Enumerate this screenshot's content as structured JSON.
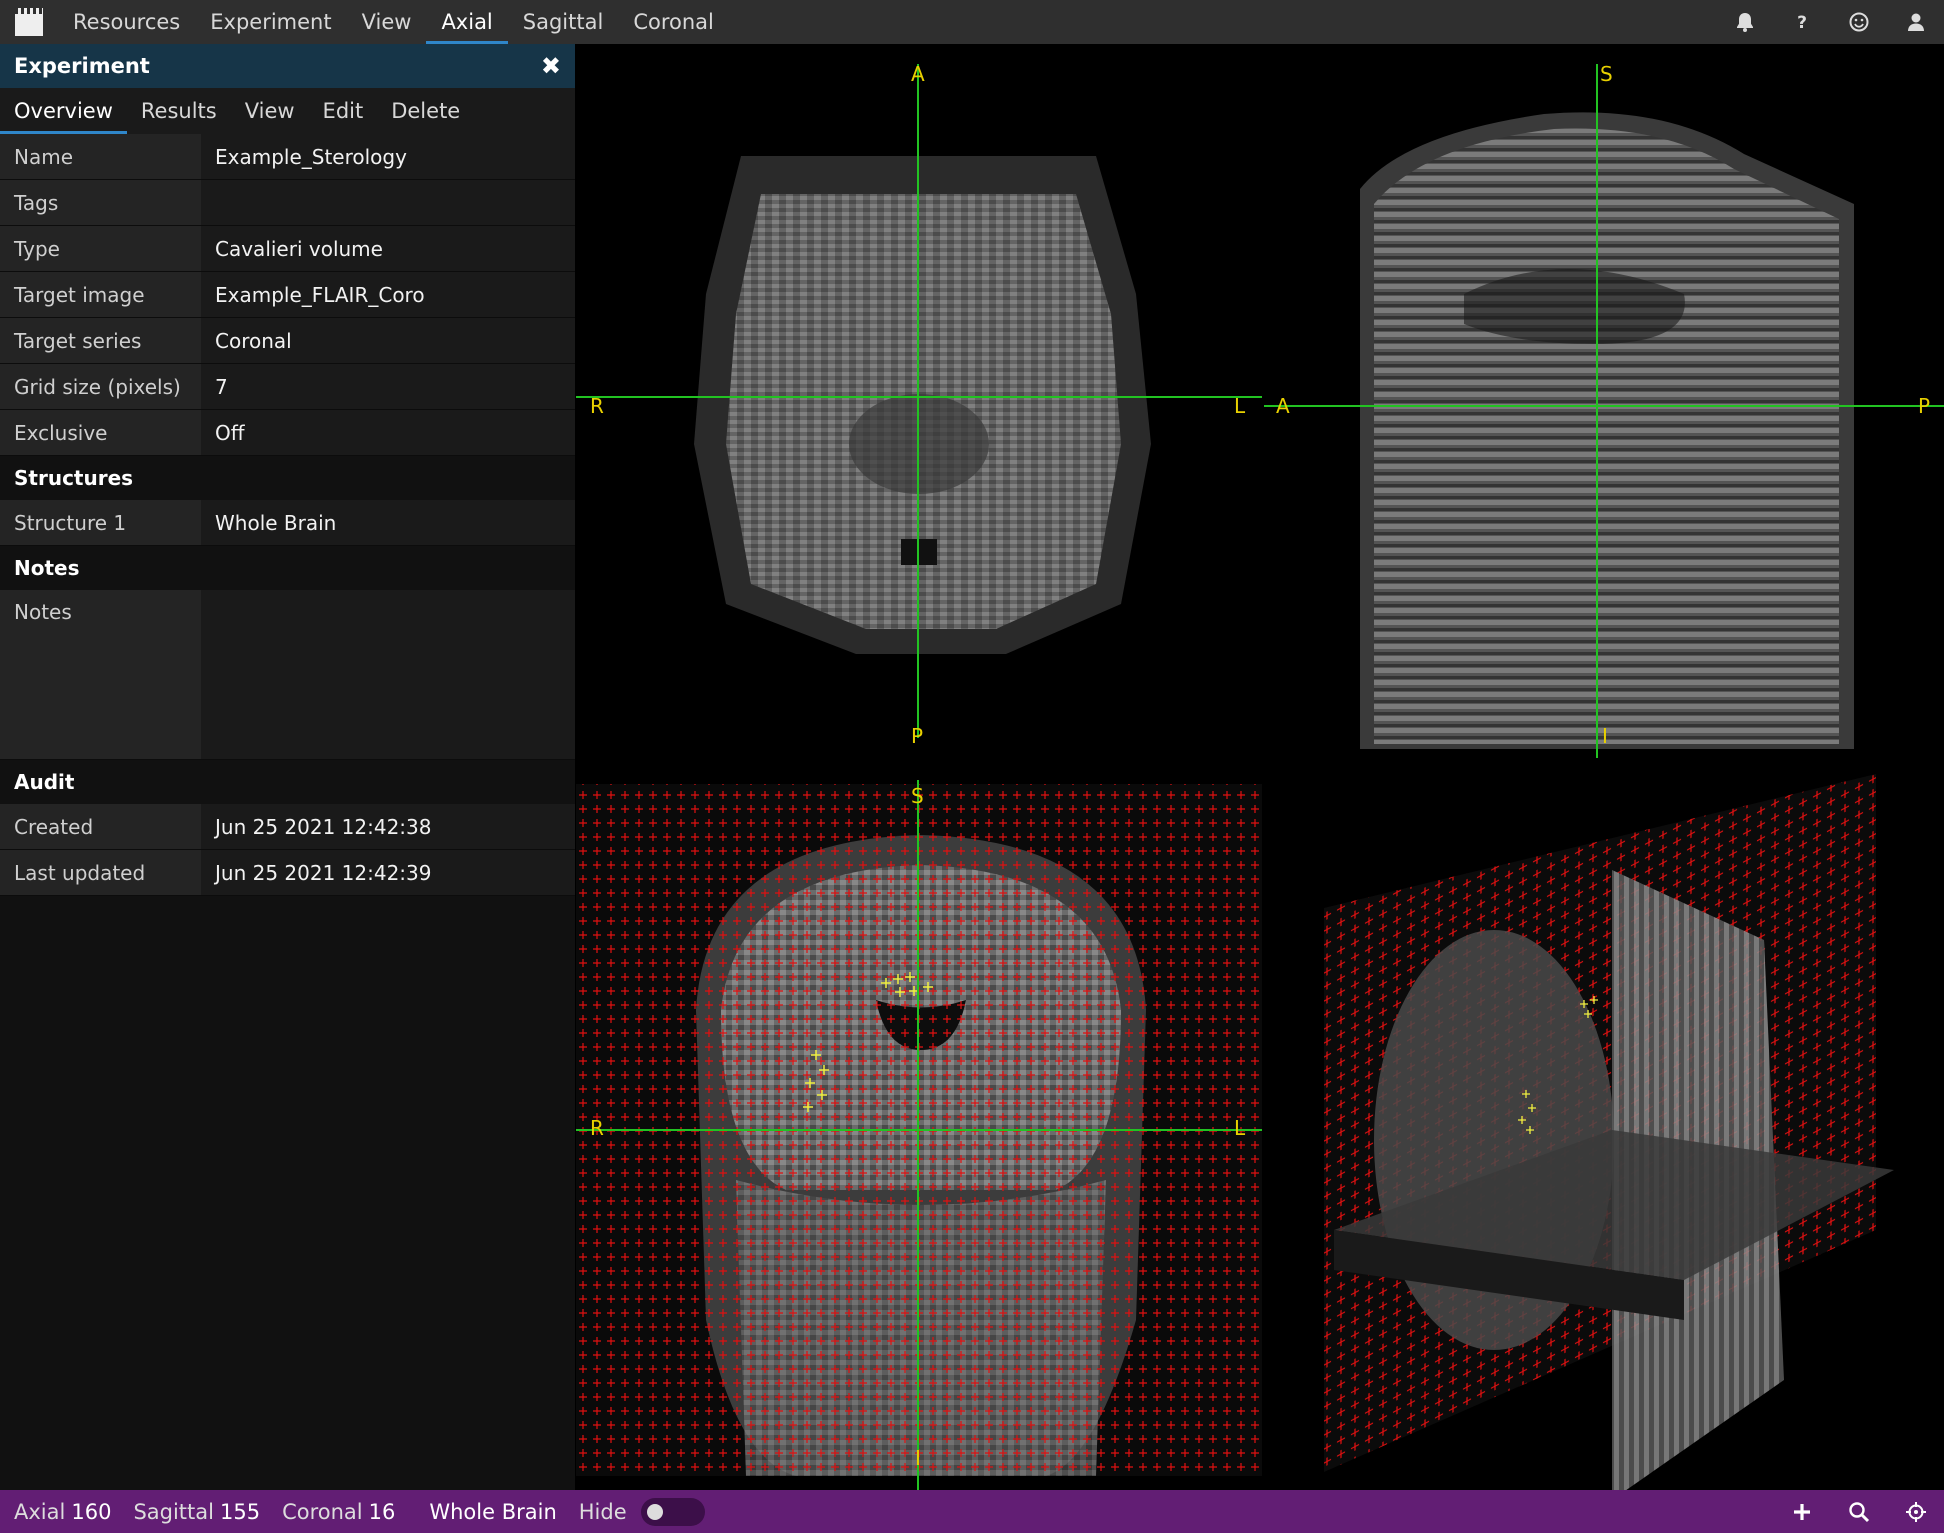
{
  "menu": {
    "items": [
      "Resources",
      "Experiment",
      "View",
      "Axial",
      "Sagittal",
      "Coronal"
    ],
    "active": "Axial",
    "icons": [
      "bell-icon",
      "help-icon",
      "smiley-icon",
      "user-icon"
    ]
  },
  "panel": {
    "title": "Experiment",
    "tabs": [
      "Overview",
      "Results",
      "View",
      "Edit",
      "Delete"
    ],
    "active_tab": "Overview",
    "details": [
      {
        "label": "Name",
        "value": "Example_Sterology"
      },
      {
        "label": "Tags",
        "value": ""
      },
      {
        "label": "Type",
        "value": "Cavalieri volume"
      },
      {
        "label": "Target image",
        "value": "Example_FLAIR_Coro"
      },
      {
        "label": "Target series",
        "value": "Coronal"
      },
      {
        "label": "Grid size (pixels)",
        "value": "7"
      },
      {
        "label": "Exclusive",
        "value": "Off"
      }
    ],
    "structures_heading": "Structures",
    "structures": [
      {
        "label": "Structure 1",
        "value": "Whole Brain"
      }
    ],
    "notes_heading": "Notes",
    "notes": {
      "label": "Notes",
      "value": ""
    },
    "audit_heading": "Audit",
    "audit": [
      {
        "label": "Created",
        "value": "Jun 25 2021 12:42:38"
      },
      {
        "label": "Last updated",
        "value": "Jun 25 2021 12:42:39"
      }
    ]
  },
  "viewports": {
    "axial": {
      "top": "A",
      "bottom": "P",
      "left": "R",
      "right": "L"
    },
    "sagittal": {
      "top": "S",
      "bottom": "I",
      "left": "A",
      "right": "P"
    },
    "coronal": {
      "top": "S",
      "bottom": "I",
      "left": "R",
      "right": "L"
    }
  },
  "colors": {
    "crosshair": "#22c322",
    "orientation_label": "#e8d000",
    "grid_points": "#e01010",
    "marked_points": "#f0f040",
    "statusbar": "#621e74",
    "panel_header": "#163548",
    "accent": "#2f86c9"
  },
  "status": {
    "axial_label": "Axial",
    "axial_value": "160",
    "sagittal_label": "Sagittal",
    "sagittal_value": "155",
    "coronal_label": "Coronal",
    "coronal_value": "16",
    "structure": "Whole Brain",
    "hide_label": "Hide",
    "hide_enabled": false,
    "icons": [
      "add-icon",
      "zoom-icon",
      "move-icon"
    ]
  }
}
